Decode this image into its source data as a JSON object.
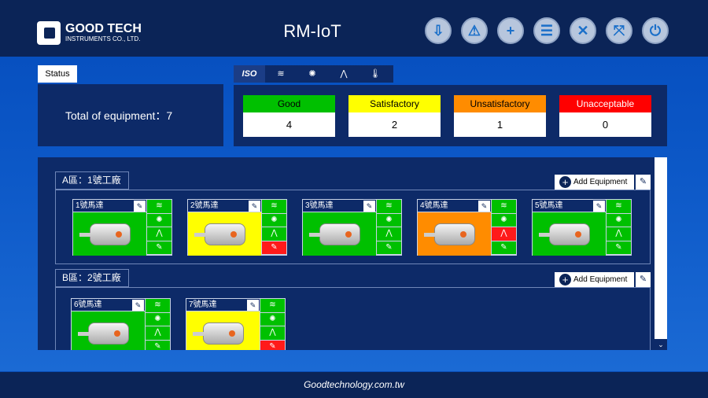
{
  "header": {
    "logo_main": "GOOD TECH",
    "logo_sub": "INSTRUMENTS CO., LTD.",
    "title": "RM-IoT",
    "buttons": [
      {
        "name": "export-icon",
        "glyph": "⇩"
      },
      {
        "name": "report-alert-icon",
        "glyph": "⚠"
      },
      {
        "name": "add-icon",
        "glyph": "+"
      },
      {
        "name": "id-card-icon",
        "glyph": "☰"
      },
      {
        "name": "tools-icon",
        "glyph": "✕"
      },
      {
        "name": "collapse-icon",
        "glyph": "⤧"
      },
      {
        "name": "power-icon",
        "glyph": "⏻"
      }
    ]
  },
  "status": {
    "tab": "Status",
    "total": "Total of equipment：7"
  },
  "icon_tabs": [
    {
      "name": "iso-icon",
      "glyph": "ISO"
    },
    {
      "name": "wifi-icon",
      "glyph": "≋"
    },
    {
      "name": "vibration-icon",
      "glyph": "✺"
    },
    {
      "name": "trend-icon",
      "glyph": "⋀"
    },
    {
      "name": "temperature-icon",
      "glyph": "🌡"
    }
  ],
  "levels": [
    {
      "label": "Good",
      "count": "4",
      "color": "#00c000"
    },
    {
      "label": "Satisfactory",
      "count": "2",
      "color": "#ffff00"
    },
    {
      "label": "Unsatisfactory",
      "count": "1",
      "color": "#ff8c00"
    },
    {
      "label": "Unacceptable",
      "count": "0",
      "color": "#ff0000",
      "text": "#ffffff"
    }
  ],
  "colors": {
    "green": "#00c000",
    "yellow": "#ffff00",
    "orange": "#ff8c00",
    "red": "#ff1a1a"
  },
  "add_label": "Add Equipment",
  "groups": [
    {
      "label": "A區：1號工廠",
      "cards": [
        {
          "name": "1號馬達",
          "status": "green",
          "sensors": [
            "green",
            "green",
            "green",
            "green"
          ]
        },
        {
          "name": "2號馬達",
          "status": "yellow",
          "sensors": [
            "green",
            "green",
            "green",
            "red"
          ]
        },
        {
          "name": "3號馬達",
          "status": "green",
          "sensors": [
            "green",
            "green",
            "green",
            "green"
          ]
        },
        {
          "name": "4號馬達",
          "status": "orange",
          "sensors": [
            "green",
            "green",
            "red",
            "green"
          ]
        },
        {
          "name": "5號馬達",
          "status": "green",
          "sensors": [
            "green",
            "green",
            "green",
            "green"
          ]
        }
      ]
    },
    {
      "label": "B區：2號工廠",
      "cards": [
        {
          "name": "6號馬達",
          "status": "green",
          "sensors": [
            "green",
            "green",
            "green",
            "green"
          ]
        },
        {
          "name": "7號馬達",
          "status": "yellow",
          "sensors": [
            "green",
            "green",
            "green",
            "red"
          ]
        }
      ]
    }
  ],
  "footer": "Goodtechnology.com.tw"
}
